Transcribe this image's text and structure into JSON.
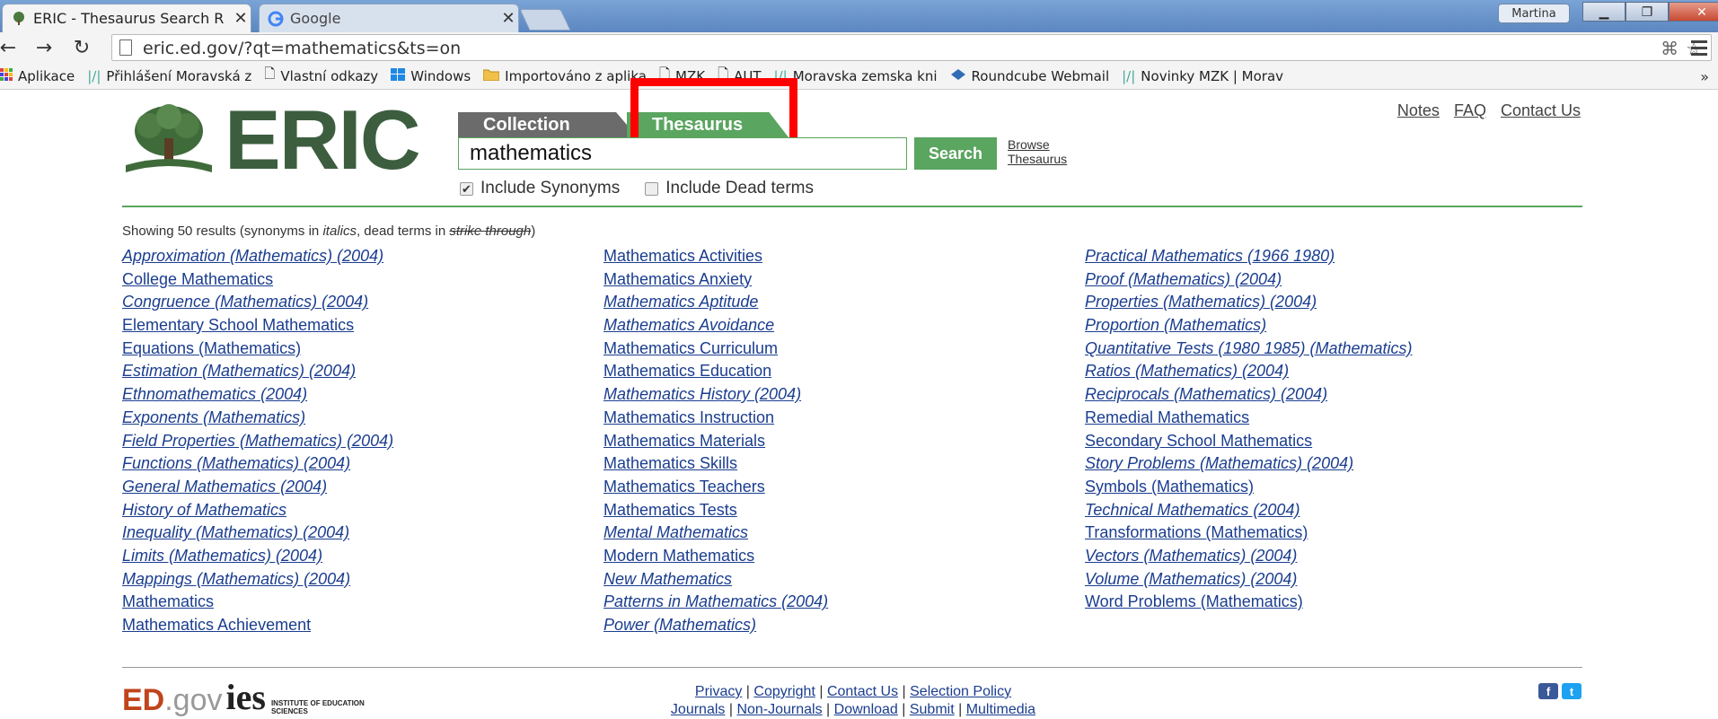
{
  "browser": {
    "tabs": [
      {
        "title": "ERIC - Thesaurus Search R",
        "icon": "tree-icon",
        "active": true
      },
      {
        "title": "Google",
        "icon": "google-icon",
        "active": false
      }
    ],
    "profile_name": "Martina",
    "url": "eric.ed.gov/?qt=mathematics&ts=on",
    "bookmarks": [
      {
        "label": "Aplikace",
        "icon": "apps-icon"
      },
      {
        "label": "Přihlášení  Moravská z",
        "icon": "bookmark-slash-icon"
      },
      {
        "label": "Vlastní odkazy",
        "icon": "page-icon"
      },
      {
        "label": "Windows",
        "icon": "windows-icon"
      },
      {
        "label": "Importováno z aplika",
        "icon": "folder-icon"
      },
      {
        "label": "MZK",
        "icon": "page-icon"
      },
      {
        "label": "AUT",
        "icon": "page-icon"
      },
      {
        "label": "Moravska zemska kni",
        "icon": "bookmark-slash-icon"
      },
      {
        "label": "Roundcube Webmail",
        "icon": "roundcube-icon"
      },
      {
        "label": "Novinky MZK | Morav",
        "icon": "bookmark-slash-icon"
      }
    ],
    "bookmarks_more": "»"
  },
  "header": {
    "logo_text": "ERIC",
    "tab_collection": "Collection",
    "tab_thesaurus": "Thesaurus",
    "search_value": "mathematics",
    "search_button": "Search",
    "browse_line1": "Browse",
    "browse_line2": "Thesaurus",
    "include_synonyms": "Include Synonyms",
    "include_synonyms_checked": true,
    "include_dead": "Include Dead terms",
    "include_dead_checked": false,
    "top_links": [
      "Notes",
      "FAQ",
      "Contact Us"
    ]
  },
  "results": {
    "showing_prefix": "Showing 50 results (synonyms in ",
    "showing_italics": "italics",
    "showing_middle": ", dead terms in ",
    "showing_strike": "strike through",
    "showing_suffix": ")",
    "columns": [
      [
        {
          "label": "Approximation (Mathematics) (2004)",
          "synonym": true
        },
        {
          "label": "College Mathematics",
          "synonym": false
        },
        {
          "label": "Congruence (Mathematics) (2004)",
          "synonym": true
        },
        {
          "label": "Elementary School Mathematics",
          "synonym": false
        },
        {
          "label": "Equations (Mathematics)",
          "synonym": false
        },
        {
          "label": "Estimation (Mathematics) (2004)",
          "synonym": true
        },
        {
          "label": "Ethnomathematics (2004)",
          "synonym": true
        },
        {
          "label": "Exponents (Mathematics)",
          "synonym": true
        },
        {
          "label": "Field Properties (Mathematics) (2004)",
          "synonym": true
        },
        {
          "label": "Functions (Mathematics) (2004)",
          "synonym": true
        },
        {
          "label": "General Mathematics (2004)",
          "synonym": true
        },
        {
          "label": "History of Mathematics",
          "synonym": true
        },
        {
          "label": "Inequality (Mathematics) (2004)",
          "synonym": true
        },
        {
          "label": "Limits (Mathematics) (2004)",
          "synonym": true
        },
        {
          "label": "Mappings (Mathematics) (2004)",
          "synonym": true
        },
        {
          "label": "Mathematics",
          "synonym": false
        },
        {
          "label": "Mathematics Achievement",
          "synonym": false
        }
      ],
      [
        {
          "label": "Mathematics Activities",
          "synonym": false
        },
        {
          "label": "Mathematics Anxiety",
          "synonym": false
        },
        {
          "label": "Mathematics Aptitude",
          "synonym": true
        },
        {
          "label": "Mathematics Avoidance",
          "synonym": true
        },
        {
          "label": "Mathematics Curriculum",
          "synonym": false
        },
        {
          "label": "Mathematics Education",
          "synonym": false
        },
        {
          "label": "Mathematics History (2004)",
          "synonym": true
        },
        {
          "label": "Mathematics Instruction",
          "synonym": false
        },
        {
          "label": "Mathematics Materials",
          "synonym": false
        },
        {
          "label": "Mathematics Skills",
          "synonym": false
        },
        {
          "label": "Mathematics Teachers",
          "synonym": false
        },
        {
          "label": "Mathematics Tests",
          "synonym": false
        },
        {
          "label": "Mental Mathematics",
          "synonym": true
        },
        {
          "label": "Modern Mathematics",
          "synonym": false
        },
        {
          "label": "New Mathematics",
          "synonym": true
        },
        {
          "label": "Patterns in Mathematics (2004)",
          "synonym": true
        },
        {
          "label": "Power (Mathematics)",
          "synonym": true
        }
      ],
      [
        {
          "label": "Practical Mathematics (1966 1980)",
          "synonym": true
        },
        {
          "label": "Proof (Mathematics) (2004)",
          "synonym": true
        },
        {
          "label": "Properties (Mathematics) (2004)",
          "synonym": true
        },
        {
          "label": "Proportion (Mathematics)",
          "synonym": true
        },
        {
          "label": "Quantitative Tests (1980 1985) (Mathematics)",
          "synonym": true
        },
        {
          "label": "Ratios (Mathematics) (2004)",
          "synonym": true
        },
        {
          "label": "Reciprocals (Mathematics) (2004)",
          "synonym": true
        },
        {
          "label": "Remedial Mathematics",
          "synonym": false
        },
        {
          "label": "Secondary School Mathematics",
          "synonym": false
        },
        {
          "label": "Story Problems (Mathematics) (2004)",
          "synonym": true
        },
        {
          "label": "Symbols (Mathematics)",
          "synonym": false
        },
        {
          "label": "Technical Mathematics (2004)",
          "synonym": true
        },
        {
          "label": "Transformations (Mathematics)",
          "synonym": false
        },
        {
          "label": "Vectors (Mathematics) (2004)",
          "synonym": true
        },
        {
          "label": "Volume (Mathematics) (2004)",
          "synonym": true
        },
        {
          "label": "Word Problems (Mathematics)",
          "synonym": false
        }
      ]
    ]
  },
  "footer": {
    "logo_ed": "ED",
    "logo_gov": ".gov",
    "logo_ies": "ies",
    "logo_ies_sub": "INSTITUTE OF EDUCATION SCIENCES",
    "links_row1": [
      "Privacy",
      "Copyright",
      "Contact Us",
      "Selection Policy"
    ],
    "links_row2": [
      "Journals",
      "Non-Journals",
      "Download",
      "Submit",
      "Multimedia"
    ],
    "social": [
      "f",
      "t"
    ]
  },
  "colors": {
    "eric_green": "#3c5e3f",
    "accent_green": "#5aa55f",
    "link_blue": "#1a3d8f",
    "highlight_red": "#ff0000"
  }
}
